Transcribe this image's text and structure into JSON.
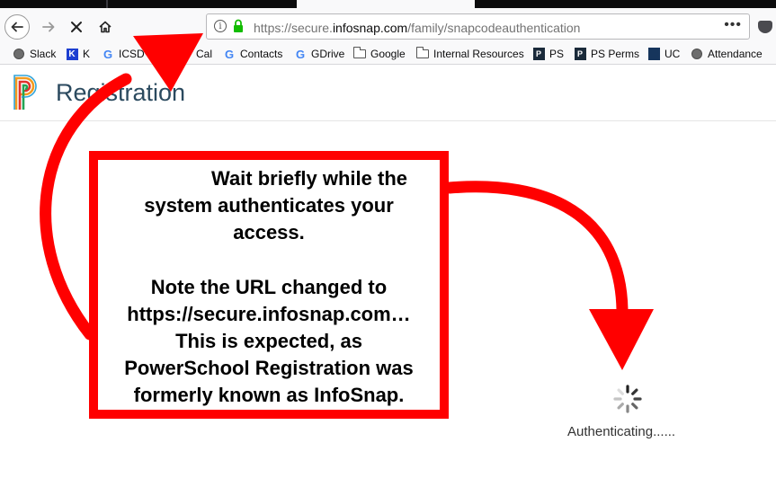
{
  "browser": {
    "url_prefix": "https://secure.",
    "url_host": "infosnap.com",
    "url_path": "/family/snapcodeauthentication",
    "page_actions": "•••",
    "bookmarks": [
      {
        "label": "Slack",
        "icon": "globe-icon"
      },
      {
        "label": "K",
        "icon": "k-icon"
      },
      {
        "label": "ICSD",
        "icon": "google-icon"
      },
      {
        "label": "Cal",
        "icon": "calendar-icon"
      },
      {
        "label": "Contacts",
        "icon": "google-icon"
      },
      {
        "label": "GDrive",
        "icon": "google-icon"
      },
      {
        "label": "Google",
        "icon": "folder-icon"
      },
      {
        "label": "Internal Resources",
        "icon": "folder-icon"
      },
      {
        "label": "PS",
        "icon": "powerschool-icon"
      },
      {
        "label": "PS Perms",
        "icon": "powerschool-icon"
      },
      {
        "label": "UC",
        "icon": "uc-icon"
      },
      {
        "label": "Attendance",
        "icon": "globe-icon"
      }
    ]
  },
  "app": {
    "title": "Registration",
    "status_text": "Authenticating......"
  },
  "callout": {
    "lines": [
      "Wait briefly while the",
      "system authenticates your",
      "access.",
      "Note the URL changed to",
      "https://secure.infosnap.com…",
      "This is expected, as",
      "PowerSchool Registration was",
      "formerly known as InfoSnap."
    ]
  },
  "colors": {
    "annotation_red": "#ff0000",
    "brand_teal": "#2b4a5f",
    "lock_green": "#12bc00"
  }
}
